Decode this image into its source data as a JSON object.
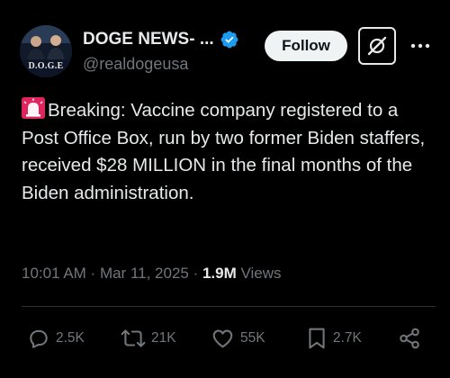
{
  "author": {
    "display_name": "DOGE NEWS- ...",
    "handle": "@realdogeusa",
    "avatar_text": "D.O.G.E",
    "verified_color": "#1d9bf0"
  },
  "header": {
    "follow_label": "Follow",
    "grok_icon": "grok-icon",
    "more_icon": "more-dots-icon"
  },
  "tweet": {
    "lead_icon": "siren-icon",
    "text": "Breaking: Vaccine company registered to a Post Office Box, run by two former Biden staffers, received $28 MILLION in the final months of the Biden administration."
  },
  "meta": {
    "time": "10:01 AM",
    "separator1": " · ",
    "date": "Mar 11, 2025",
    "separator2": " · ",
    "views_count": "1.9M",
    "views_label": " Views"
  },
  "actions": {
    "replies": "2.5K",
    "reposts": "21K",
    "likes": "55K",
    "bookmarks": "2.7K"
  },
  "colors": {
    "background": "#000000",
    "primary_text": "#e7e9ea",
    "secondary_text": "#71767b",
    "divider": "#2f3336",
    "siren_red": "#e0245e"
  }
}
